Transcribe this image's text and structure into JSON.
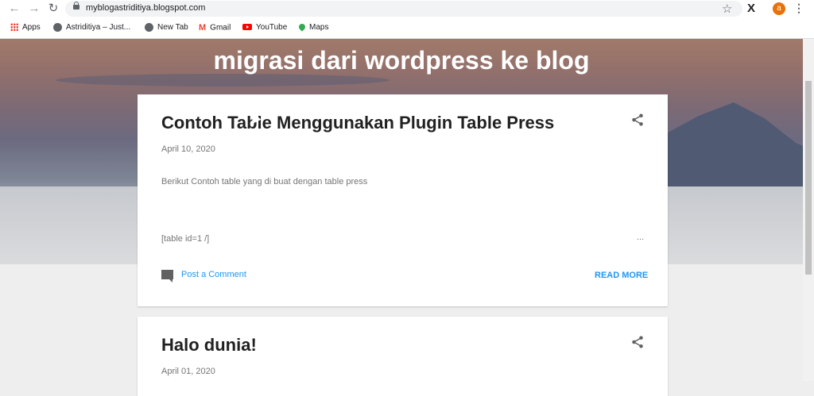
{
  "browser": {
    "url": "myblogastriditiya.blogspot.com",
    "avatar_letter": "a",
    "bookmarks": [
      {
        "label": "Apps"
      },
      {
        "label": "Astriditiya – Just..."
      },
      {
        "label": "New Tab"
      },
      {
        "label": "Gmail"
      },
      {
        "label": "YouTube"
      },
      {
        "label": "Maps"
      }
    ]
  },
  "blog": {
    "title": "migrasi dari wordpress ke blog"
  },
  "posts": [
    {
      "title": "Contoh Table Menggunakan Plugin Table Press",
      "date": "April 10, 2020",
      "excerpt": "Berikut Contoh table yang di buat dengan table press",
      "shortcode": "[table id=1 /]",
      "ellipsis": "...",
      "comment_label": "Post a Comment",
      "read_more": "READ MORE"
    },
    {
      "title": "Halo dunia!",
      "date": "April 01, 2020"
    }
  ],
  "colors": {
    "link": "#2196f3",
    "accent_avatar": "#e8710a"
  }
}
